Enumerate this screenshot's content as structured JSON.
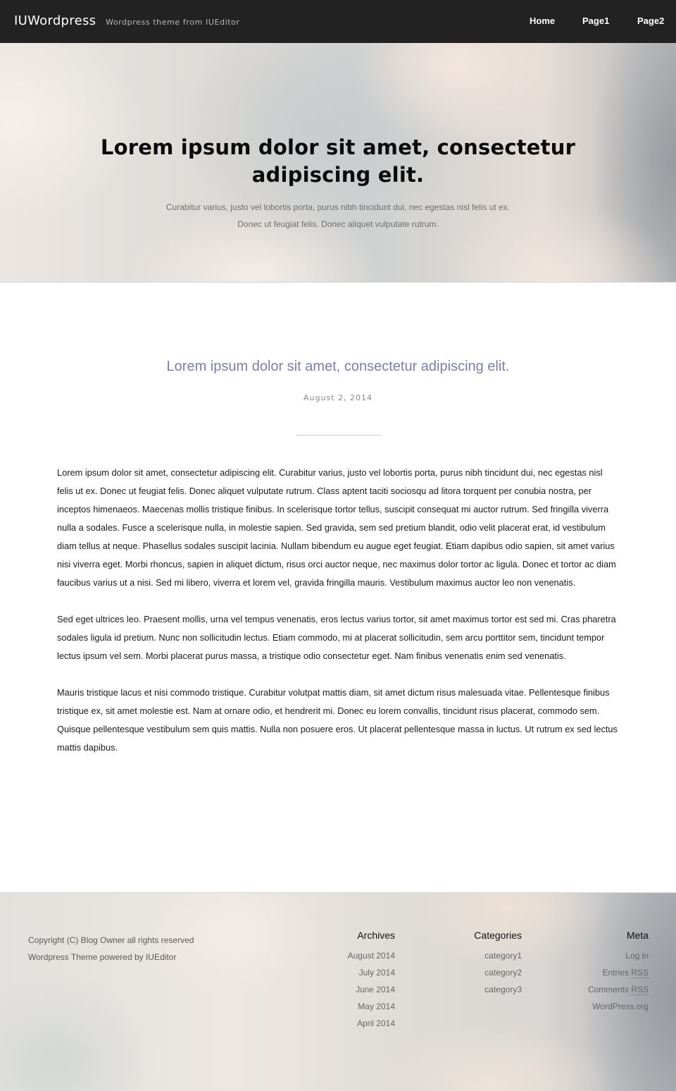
{
  "header": {
    "brand": "IUWordpress",
    "tagline": "Wordpress theme from IUEditor",
    "nav": [
      "Home",
      "Page1",
      "Page2"
    ]
  },
  "hero": {
    "title": "Lorem ipsum dolor sit amet, consectetur adipiscing elit.",
    "subtitle_line1": "Curabitur varius, justo vel lobortis porta, purus nibh tincidunt dui, nec egestas nisl felis ut ex.",
    "subtitle_line2": "Donec ut feugiat felis. Donec aliquet vulputate rutrum."
  },
  "post": {
    "title": "Lorem ipsum dolor sit amet, consectetur adipiscing elit.",
    "date": "August 2, 2014",
    "paragraphs": [
      "Lorem ipsum dolor sit amet, consectetur adipiscing elit. Curabitur varius, justo vel lobortis porta, purus nibh tincidunt dui, nec egestas nisl felis ut ex. Donec ut feugiat felis. Donec aliquet vulputate rutrum. Class aptent taciti sociosqu ad litora torquent per conubia nostra, per inceptos himenaeos. Maecenas mollis tristique finibus. In scelerisque tortor tellus, suscipit consequat mi auctor rutrum. Sed fringilla viverra nulla a sodales. Fusce a scelerisque nulla, in molestie sapien. Sed gravida, sem sed pretium blandit, odio velit placerat erat, id vestibulum diam tellus at neque. Phasellus sodales suscipit lacinia. Nullam bibendum eu augue eget feugiat. Etiam dapibus odio sapien, sit amet varius nisi viverra eget. Morbi rhoncus, sapien in aliquet dictum, risus orci auctor neque, nec maximus dolor tortor ac ligula. Donec et tortor ac diam faucibus varius ut a nisi. Sed mi libero, viverra et lorem vel, gravida fringilla mauris. Vestibulum maximus auctor leo non venenatis.",
      "Sed eget ultrices leo. Praesent mollis, urna vel tempus venenatis, eros lectus varius tortor, sit amet maximus tortor est sed mi. Cras pharetra sodales ligula id pretium. Nunc non sollicitudin lectus. Etiam commodo, mi at placerat sollicitudin, sem arcu porttitor sem, tincidunt tempor lectus ipsum vel sem. Morbi placerat purus massa, a tristique odio consectetur eget. Nam finibus venenatis enim sed venenatis.",
      "Mauris tristique lacus et nisi commodo tristique. Curabitur volutpat mattis diam, sit amet dictum risus malesuada vitae. Pellentesque finibus tristique ex, sit amet molestie est. Nam at ornare odio, et hendrerit mi. Donec eu lorem convallis, tincidunt risus placerat, commodo sem. Quisque pellentesque vestibulum sem quis mattis. Nulla non posuere eros. Ut placerat pellentesque massa in luctus. Ut rutrum ex sed lectus mattis dapibus."
    ]
  },
  "footer": {
    "copyright_line1": "Copyright (C) Blog Owner all rights reserved",
    "copyright_line2": "Wordpress Theme powered by IUEditor",
    "archives": {
      "heading": "Archives",
      "items": [
        "August 2014",
        "July 2014",
        "June 2014",
        "May 2014",
        "April 2014"
      ]
    },
    "categories": {
      "heading": "Categories",
      "items": [
        "category1",
        "category2",
        "category3"
      ]
    },
    "meta": {
      "heading": "Meta",
      "log_in": "Log in",
      "entries_prefix": "Entries ",
      "comments_prefix": "Comments ",
      "rss": "RSS",
      "wordpress_org": "WordPress.org"
    }
  },
  "colors": {
    "topbar_bg": "#222222",
    "post_title": "#7a7fb2"
  }
}
